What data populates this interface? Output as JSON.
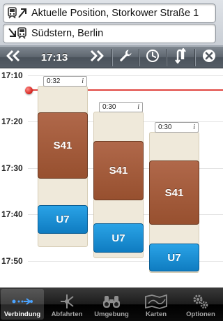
{
  "route": {
    "from": "Aktuelle Position, Storkower Straße 1",
    "to": "Südstern, Berlin",
    "from_icon": "train-to-icon",
    "to_icon": "train-from-icon"
  },
  "toolbar": {
    "prev_icon": "double-chevron-left-icon",
    "time": "17:13",
    "next_icon": "double-chevron-right-icon",
    "settings_icon": "wrench-icon",
    "clock_icon": "clock-icon",
    "swap_icon": "swap-arrows-icon",
    "close_icon": "close-icon"
  },
  "timetable": {
    "ticks": [
      "17:10",
      "17:20",
      "17:30",
      "17:40",
      "17:50"
    ],
    "current_time_color": "#e0443f",
    "connections": [
      {
        "duration": "0:32",
        "info": "i",
        "segments": [
          {
            "line": "S41",
            "type": "sbahn"
          },
          {
            "line": "U7",
            "type": "ubahn"
          }
        ]
      },
      {
        "duration": "0:30",
        "info": "i",
        "segments": [
          {
            "line": "S41",
            "type": "sbahn"
          },
          {
            "line": "U7",
            "type": "ubahn"
          }
        ]
      },
      {
        "duration": "0:30",
        "info": "i",
        "segments": [
          {
            "line": "S41",
            "type": "sbahn"
          },
          {
            "line": "U7",
            "type": "ubahn"
          }
        ]
      }
    ],
    "colors": {
      "sbahn": "#9f5737",
      "ubahn": "#1a8fd6"
    }
  },
  "tabs": [
    {
      "label": "Verbindung",
      "icon": "route-connection-icon",
      "active": true
    },
    {
      "label": "Abfahrten",
      "icon": "departures-icon",
      "active": false
    },
    {
      "label": "Umgebung",
      "icon": "binoculars-icon",
      "active": false
    },
    {
      "label": "Karten",
      "icon": "map-icon",
      "active": false
    },
    {
      "label": "Optionen",
      "icon": "gears-icon",
      "active": false
    }
  ]
}
